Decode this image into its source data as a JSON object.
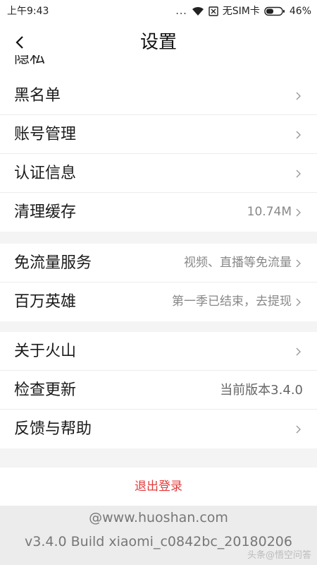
{
  "status_bar": {
    "time": "上午9:43",
    "dots": "...",
    "sim": "无SIM卡",
    "battery": "46%"
  },
  "header": {
    "title": "设置"
  },
  "partial_item": {
    "label": "隐私"
  },
  "groups": [
    {
      "items": [
        {
          "label": "黑名单",
          "value": ""
        },
        {
          "label": "账号管理",
          "value": ""
        },
        {
          "label": "认证信息",
          "value": ""
        },
        {
          "label": "清理缓存",
          "value": "10.74M"
        }
      ]
    },
    {
      "items": [
        {
          "label": "免流量服务",
          "value": "视频、直播等免流量"
        },
        {
          "label": "百万英雄",
          "value": "第一季已结束，去提现"
        }
      ]
    },
    {
      "items": [
        {
          "label": "关于火山",
          "value": ""
        },
        {
          "label": "检查更新",
          "value": "当前版本3.4.0"
        },
        {
          "label": "反馈与帮助",
          "value": ""
        }
      ]
    }
  ],
  "logout_label": "退出登录",
  "footer": {
    "website": "@www.huoshan.com",
    "build": "v3.4.0 Build xiaomi_c0842bc_20180206"
  },
  "watermark": "头条@悟空问答",
  "colors": {
    "accent": "#e33a3a",
    "background": "#f4f4f4",
    "separator": "#ececec"
  }
}
